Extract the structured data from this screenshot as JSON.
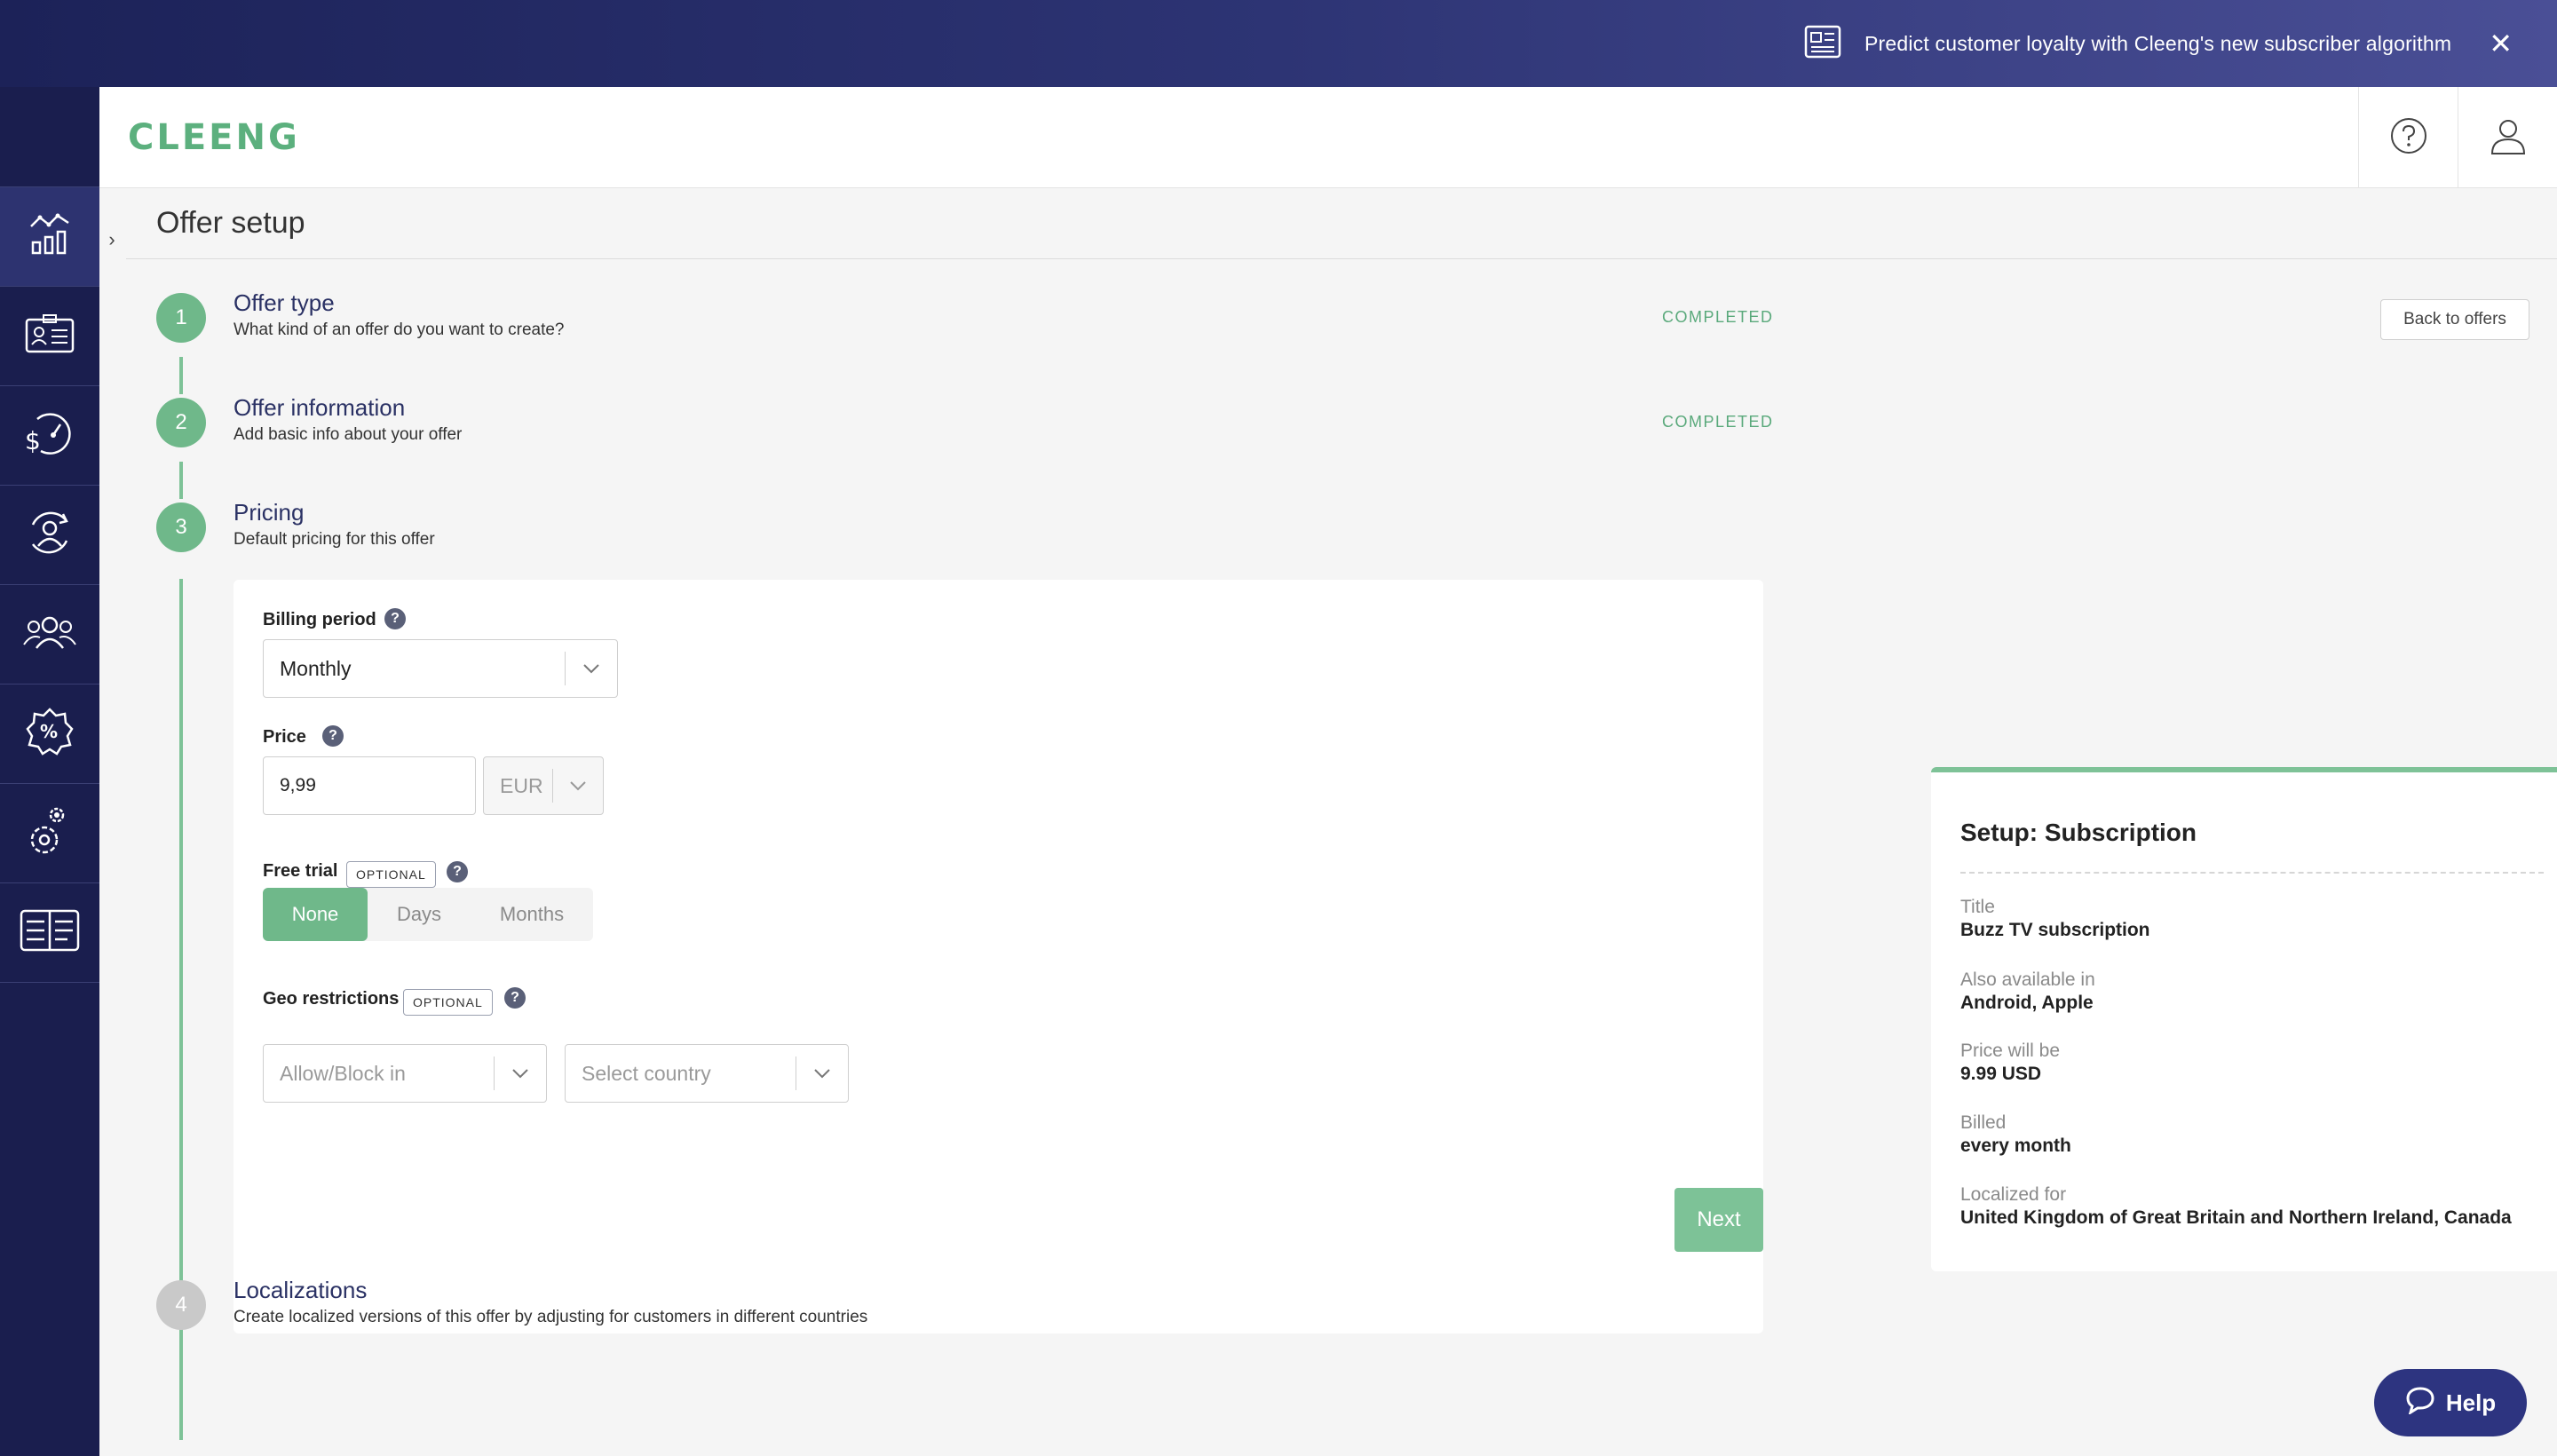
{
  "banner": {
    "text": "Predict customer loyalty with Cleeng's new subscriber algorithm",
    "close": "✕"
  },
  "header": {
    "logo": "CLEENG"
  },
  "page": {
    "title": "Offer setup",
    "toggle": "›",
    "back_label": "Back to offers"
  },
  "steps": [
    {
      "number": "1",
      "title": "Offer type",
      "subtitle": "What kind of an offer do you want to create?",
      "status": "COMPLETED"
    },
    {
      "number": "2",
      "title": "Offer information",
      "subtitle": "Add basic info about your offer",
      "status": "COMPLETED"
    },
    {
      "number": "3",
      "title": "Pricing",
      "subtitle": "Default pricing for this offer"
    },
    {
      "number": "4",
      "title": "Localizations",
      "subtitle": "Create localized versions of this offer by adjusting for customers in different countries"
    }
  ],
  "pricing": {
    "billing_label": "Billing period",
    "billing_value": "Monthly",
    "price_label": "Price",
    "price_value": "9,99",
    "currency": "EUR",
    "trial_label": "Free trial",
    "optional": "OPTIONAL",
    "trial_options": [
      "None",
      "Days",
      "Months"
    ],
    "geo_label": "Geo restrictions",
    "geo_mode_placeholder": "Allow/Block in",
    "geo_country_placeholder": "Select country",
    "help_mark": "?",
    "next_label": "Next"
  },
  "summary": {
    "title": "Setup: Subscription",
    "rows": [
      {
        "label": "Title",
        "value": "Buzz TV subscription"
      },
      {
        "label": "Also available in",
        "value": "Android, Apple"
      },
      {
        "label": "Price will be",
        "value": "9.99 USD"
      },
      {
        "label": "Billed",
        "value": "every month"
      },
      {
        "label": "Localized for",
        "value": "United Kingdom of Great Britain and Northern Ireland, Canada"
      }
    ]
  },
  "help_button": "Help",
  "colors": {
    "accent_green": "#6fb88a",
    "navy": "#1a1e4e"
  }
}
